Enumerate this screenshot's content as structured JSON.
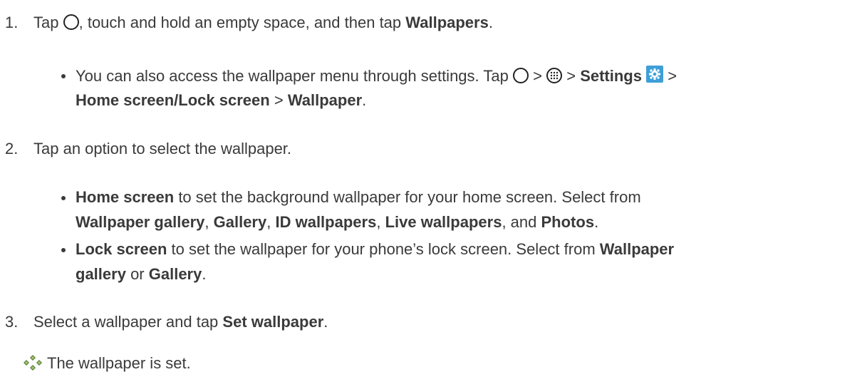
{
  "step1": {
    "number": "1.",
    "text_a": "Tap",
    "text_b": ", touch and hold an empty space, and then tap",
    "bold_a": "Wallpapers",
    "text_c": "."
  },
  "step1_sub": {
    "text_a": "You can also access the wallpaper menu through settings. Tap",
    "sep1": ">",
    "sep2": ">",
    "bold_settings": "Settings",
    "sep3": ">",
    "bold_home_lock": "Home screen/Lock screen",
    "sep4": ">",
    "bold_wallpaper": "Wallpaper",
    "end": "."
  },
  "step2": {
    "number": "2.",
    "text": "Tap an option to select the wallpaper."
  },
  "step2_sub1": {
    "bold_home": "Home screen",
    "text_a": "to set the background wallpaper for your home screen. Select from",
    "bold_wg": "Wallpaper gallery",
    "comma1": ",",
    "bold_gallery": "Gallery",
    "comma2": ",",
    "bold_id": "ID wallpapers",
    "comma3": ",",
    "bold_live": "Live wallpapers",
    "text_and": ", and",
    "bold_photos": "Photos",
    "end": "."
  },
  "step2_sub2": {
    "bold_lock": "Lock screen",
    "text_a": "to set the wallpaper for your phone’s lock screen. Select from",
    "bold_wallpaper": "Wallpaper",
    "bold_gallery_word": "gallery",
    "text_or": "or",
    "bold_gallery": "Gallery",
    "end": "."
  },
  "step3": {
    "number": "3.",
    "text_a": "Select a wallpaper and tap",
    "bold_set": "Set wallpaper",
    "end": "."
  },
  "result": {
    "text": "The wallpaper is set."
  },
  "icons": {
    "home": "home-circle-icon",
    "apps": "apps-icon",
    "settings": "settings-gear-icon",
    "result": "result-diamond-icon",
    "settings_color": "#3d9fd8"
  }
}
